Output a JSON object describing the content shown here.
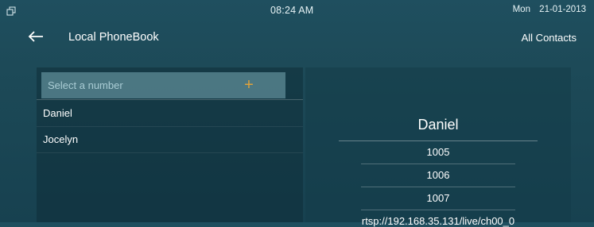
{
  "status_bar": {
    "time": "08:24 AM",
    "day": "Mon",
    "date": "21-01-2013"
  },
  "header": {
    "title": "Local PhoneBook",
    "filter_label": "All Contacts"
  },
  "search": {
    "placeholder": "Select a number",
    "add_label": "+"
  },
  "contacts": [
    {
      "name": "Daniel"
    },
    {
      "name": "Jocelyn"
    }
  ],
  "detail": {
    "name": "Daniel",
    "numbers": [
      "1005",
      "1006",
      "1007"
    ],
    "rtsp": "rtsp://192.168.35.131/live/ch00_0"
  },
  "colors": {
    "accent_add": "#e0a23a",
    "background": "#1d4a58",
    "search_field": "#6fa3ad"
  }
}
